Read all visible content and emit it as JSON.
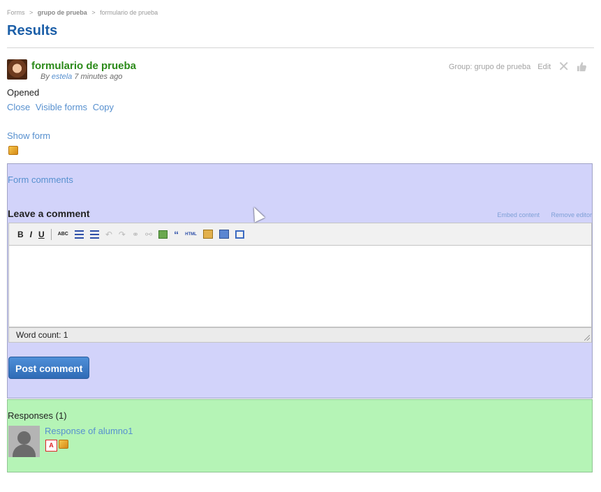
{
  "breadcrumb": {
    "items": [
      "Forms",
      "grupo de prueba",
      "formulario de prueba"
    ],
    "separator": ">"
  },
  "page": {
    "title": "Results"
  },
  "item": {
    "title": "formulario de prueba",
    "by_prefix": "By",
    "author": "estela",
    "time": "7 minutes ago",
    "group_label": "Group: grupo de prueba",
    "edit_label": "Edit",
    "status": "Opened",
    "actions": [
      "Close",
      "Visible forms",
      "Copy"
    ],
    "show_form_label": "Show form"
  },
  "comments": {
    "section_label": "Form comments",
    "leave_label": "Leave a comment",
    "editor_links": [
      "Embed content",
      "Remove editor"
    ],
    "toolbar": {
      "bold": "B",
      "italic": "I",
      "underline": "U",
      "spellcheck": "ABC",
      "quote": "“",
      "html": "HTML"
    },
    "word_count": "Word count: 1",
    "post_button": "Post comment"
  },
  "responses": {
    "label": "Responses (1)",
    "items": [
      {
        "link": "Response of alumno1",
        "pdf_label": "A"
      }
    ]
  },
  "colors": {
    "title_blue": "#1c5fa8",
    "link_blue": "#5790cf",
    "item_green": "#2b8a19",
    "comments_bg": "#d2d3fa",
    "responses_bg": "#b5f4b6",
    "button_blue": "#3877c5"
  }
}
